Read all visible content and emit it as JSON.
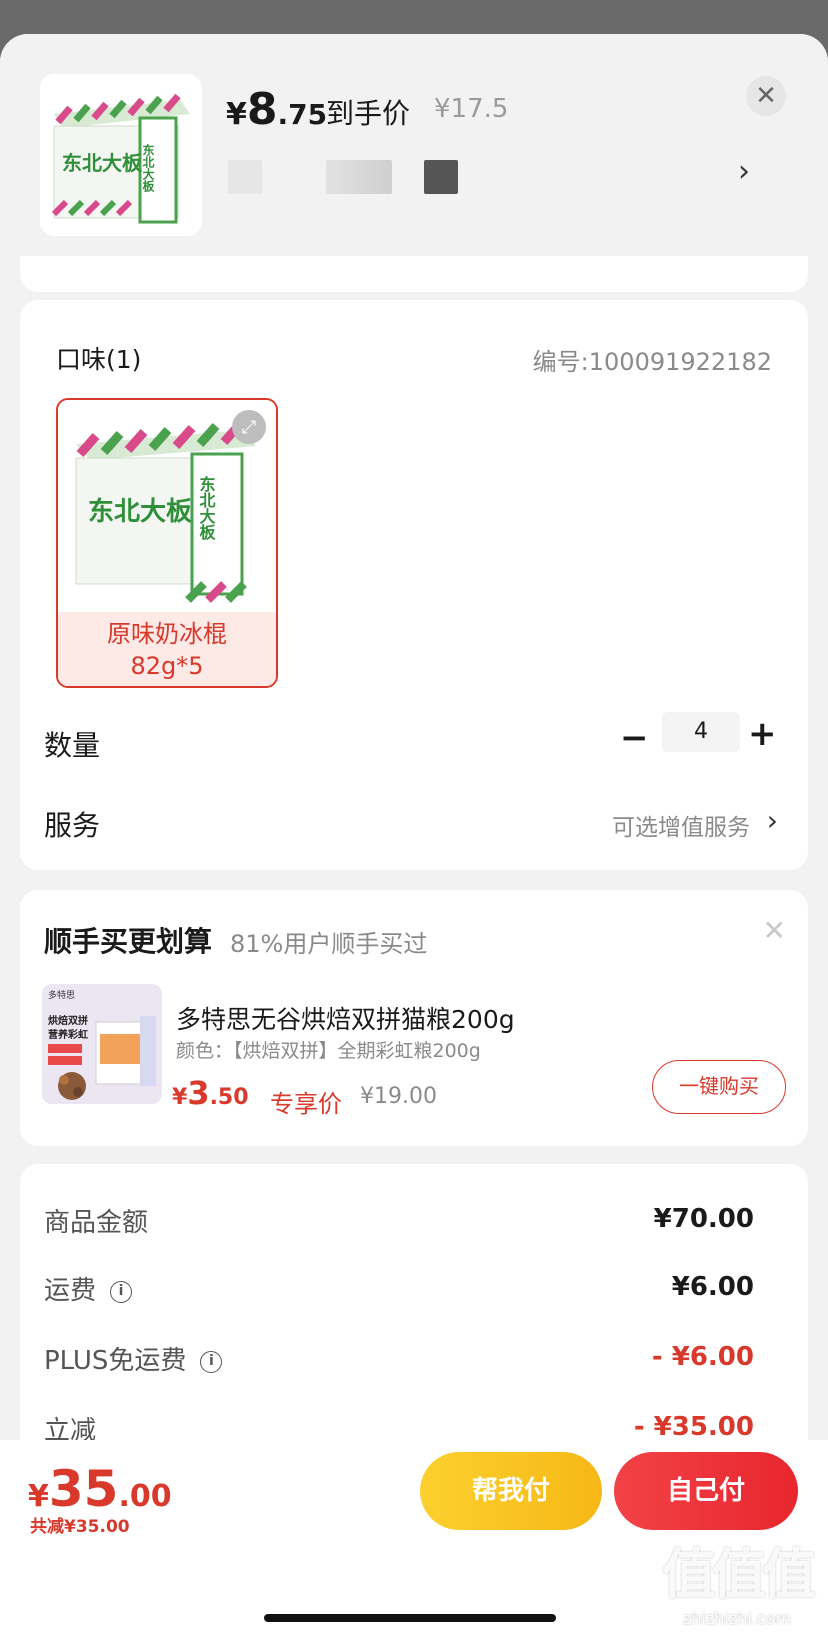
{
  "header": {
    "price_yen": "¥",
    "price_int": "8",
    "price_dec": ".75",
    "price_label": "到手价",
    "original_price": "¥17.5",
    "close_icon": "close-icon"
  },
  "spec": {
    "title": "口味(1)",
    "code": "编号:100091922182",
    "option_name": "原味奶冰棍",
    "option_size": "82g*5",
    "product_brand": "东北大板",
    "expand_icon": "expand-icon"
  },
  "quantity": {
    "label": "数量",
    "value": "4",
    "minus": "−",
    "plus": "+"
  },
  "service": {
    "label": "服务",
    "value": "可选增值服务"
  },
  "bundle": {
    "title": "顺手买更划算",
    "subtitle": "81%用户顺手买过",
    "product_name": "多特思无谷烘焙双拼猫粮200g",
    "product_color": "颜色：【烘焙双拼】全期彩虹粮200g",
    "price_yen": "¥",
    "price_int": "3",
    "price_dec": ".50",
    "price_tag": "专享价",
    "original_price": "¥19.00",
    "buy_button": "一键购买",
    "image_brand": "多特思",
    "image_text": "烘焙双拼\n营养彩虹"
  },
  "summary": {
    "rows": [
      {
        "label": "商品金额",
        "value": "¥70.00",
        "info": false,
        "highlight": false
      },
      {
        "label": "运费",
        "value": "¥6.00",
        "info": true,
        "highlight": false
      },
      {
        "label": "PLUS免运费",
        "value": "- ¥6.00",
        "info": true,
        "highlight": true
      },
      {
        "label": "立减",
        "value": "- ¥35.00",
        "info": false,
        "highlight": true
      }
    ]
  },
  "footer": {
    "total_yen": "¥",
    "total_int": "35",
    "total_dec": ".00",
    "total_saved": "共减¥35.00",
    "help_pay": "帮我付",
    "self_pay": "自己付"
  },
  "watermark": {
    "logo": "值值值",
    "site": "zhizhizhi.com"
  },
  "colors": {
    "accent_red": "#d8392b",
    "pay_yellow": "#f6b816",
    "pay_red": "#e8262e"
  }
}
